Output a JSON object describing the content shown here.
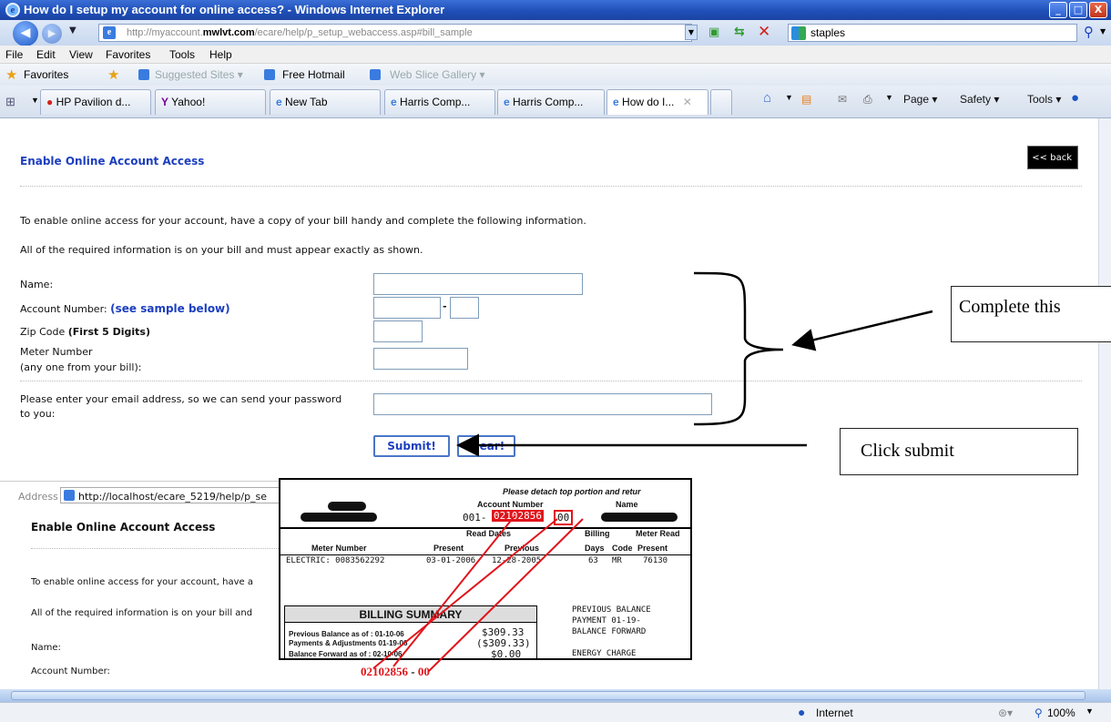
{
  "window": {
    "title": "How do I setup my account for online access? - Windows Internet Explorer",
    "controls": [
      "_",
      "□",
      "X"
    ]
  },
  "address_bar": {
    "url_prefix": "http://myaccount.",
    "url_domain": "mwlvt.com",
    "url_suffix": "/ecare/help/p_setup_webaccess.asp#bill_sample",
    "search_value": "staples"
  },
  "menu": [
    "File",
    "Edit",
    "View",
    "Favorites",
    "Tools",
    "Help"
  ],
  "favorites_bar": {
    "favorites_label": "Favorites",
    "items": [
      "Suggested Sites ▾",
      "Free Hotmail",
      "Web Slice Gallery ▾"
    ]
  },
  "tabs": [
    "HP Pavilion d...",
    "Yahoo!",
    "New Tab",
    "Harris Comp...",
    "Harris Comp...",
    "How do I..."
  ],
  "command_bar": [
    "Page ▾",
    "Safety ▾",
    "Tools ▾"
  ],
  "page": {
    "heading": "Enable Online Account Access",
    "back_button": "<< back",
    "intro1": "To enable online access for your account, have a copy of your bill handy and complete the following information.",
    "intro2": "All of the required information is on your bill and must appear exactly as shown.",
    "name_label": "Name:",
    "account_label": "Account Number:",
    "account_link": "(see sample below)",
    "zip_label": "Zip Code",
    "zip_hint": "(First 5 Digits)",
    "meter_label": "Meter Number",
    "meter_hint": "(any one from your bill):",
    "email_label_1": "Please enter your email address, so we can send your password",
    "email_label_2": "to you:",
    "submit": "Submit!",
    "clear": "Clear!"
  },
  "sample": {
    "address_label": "Address",
    "address_url": "http://localhost/ecare_5219/help/p_se",
    "heading": "Enable Online Account Access",
    "intro1": "To enable online access for your account, have a",
    "intro2": "All of the required information is on your bill and",
    "name_label": "Name:",
    "account_label": "Account Number:"
  },
  "bill": {
    "detach": "Please detach top portion and retur",
    "account_number_label": "Account Number",
    "name_label": "Name",
    "account_prefix": "001-",
    "account_main": "02102856",
    "account_suffix": "00",
    "read_dates": "Read Dates",
    "billing": "Billing",
    "meter_read": "Meter Read",
    "meter_number": "Meter Number",
    "present": "Present",
    "previous": "Previous",
    "days": "Days",
    "code": "Code",
    "present2": "Present",
    "row": "ELECTRIC: 0083562292",
    "row_present": "03-01-2006",
    "row_previous": "12-28-2005",
    "row_days": "63",
    "row_code": "MR",
    "row_read": "76130",
    "summary_title": "BILLING SUMMARY",
    "prev_balance": "Previous Balance as of : 01-10-06",
    "prev_amount": "$309.33",
    "payments": "Payments & Adjustments 01-19-06",
    "payments_amount": "($309.33)",
    "forward": "Balance Forward as of : 02-10-06",
    "forward_amount": "$0.00",
    "right1": "PREVIOUS BALANCE",
    "right2": "PAYMENT   01-19-",
    "right3": "BALANCE FORWARD",
    "right4": "ENERGY CHARGE",
    "callout_main": "02102856",
    "callout_dash": "-",
    "callout_suffix": "00"
  },
  "annotations": {
    "complete": "Complete this",
    "click": "Click submit"
  },
  "status": {
    "zone": "Internet",
    "zoom": "100%"
  },
  "colors": {
    "link": "#1c3fbf",
    "highlight": "#e0141b",
    "titlebar": "#1f4fb8"
  }
}
